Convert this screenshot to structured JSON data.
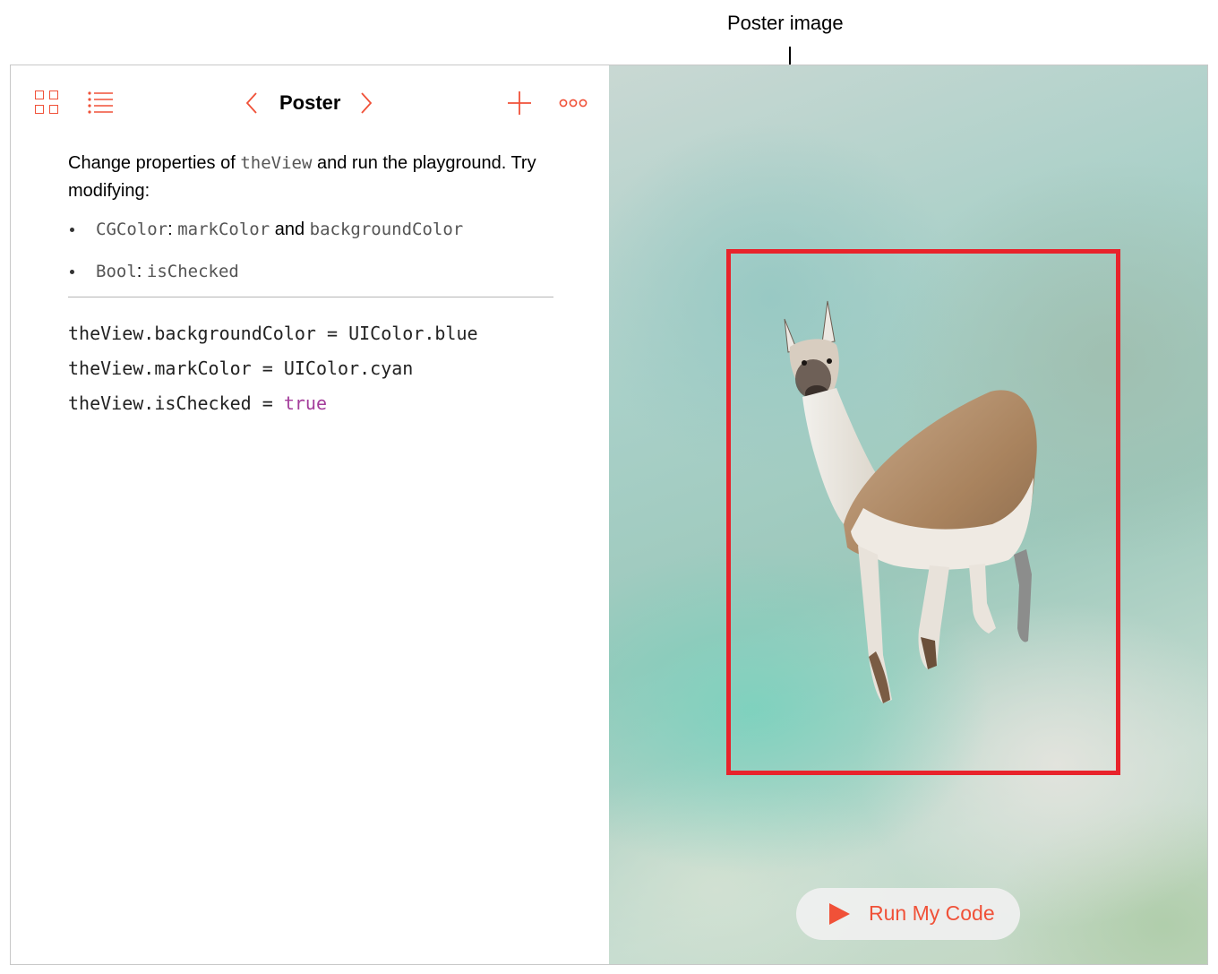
{
  "callout": {
    "label": "Poster image"
  },
  "toolbar": {
    "title": "Poster",
    "icons": [
      "grid-icon",
      "list-icon",
      "chevron-left-icon",
      "chevron-right-icon",
      "plus-icon",
      "more-icon"
    ],
    "accent_color": "#f05138"
  },
  "prose": {
    "intro_prefix": "Change properties of ",
    "intro_code": "theView",
    "intro_suffix": " and run the playground. Try modifying:",
    "bullets": [
      {
        "type": "CGColor",
        "sep": ": ",
        "prop1": "markColor",
        "and": " and ",
        "prop2": "backgroundColor"
      },
      {
        "type": "Bool",
        "sep": ": ",
        "prop1": "isChecked"
      }
    ]
  },
  "code": {
    "lines": [
      {
        "text": "theView.backgroundColor = UIColor.blue",
        "keyword": ""
      },
      {
        "text": "theView.markColor = UIColor.cyan",
        "keyword": ""
      },
      {
        "text": "theView.isChecked = ",
        "keyword": "true"
      }
    ],
    "keyword_color": "#a43d9b"
  },
  "liveview": {
    "poster_border_color": "#e8232b",
    "image_subject": "llama-image"
  },
  "run_button": {
    "label": "Run My Code",
    "icon": "play-icon"
  }
}
